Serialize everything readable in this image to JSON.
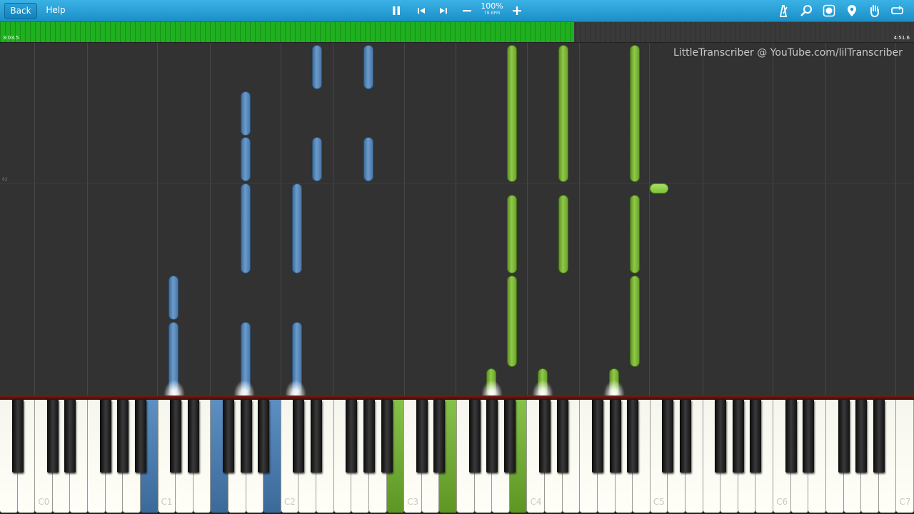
{
  "toolbar": {
    "back_label": "Back",
    "help_label": "Help",
    "zoom_percent": "100%",
    "tempo": "79 BPM",
    "icons": [
      "pause-icon",
      "skip-back-icon",
      "skip-forward-icon",
      "minus-icon",
      "plus-icon",
      "metronome-icon",
      "search-icon",
      "label-toggle-icon",
      "location-pin-icon",
      "hand-icon",
      "loop-icon"
    ]
  },
  "progress": {
    "start_time": "3:03.5",
    "end_time": "4:51.6",
    "fraction": 0.628
  },
  "roll": {
    "watermark": "LittleTranscriber @ YouTube.com/lilTranscriber",
    "row_label": "62"
  },
  "keyboard": {
    "octave_labels": [
      "C0",
      "C1",
      "C2",
      "C3",
      "C4",
      "C5",
      "C6",
      "C7"
    ],
    "pressed": [
      {
        "key": "B1",
        "hand": "left"
      },
      {
        "key": "F2",
        "hand": "left"
      },
      {
        "key": "B2",
        "hand": "left"
      },
      {
        "key": "B3",
        "hand": "right"
      },
      {
        "key": "E4",
        "hand": "right"
      },
      {
        "key": "B4",
        "hand": "right"
      }
    ]
  },
  "colors": {
    "toolbar": "#1f97d0",
    "progress_fill": "#1fb01f",
    "left_hand": "#5585b8",
    "right_hand": "#7cb33a",
    "background": "#323232"
  }
}
